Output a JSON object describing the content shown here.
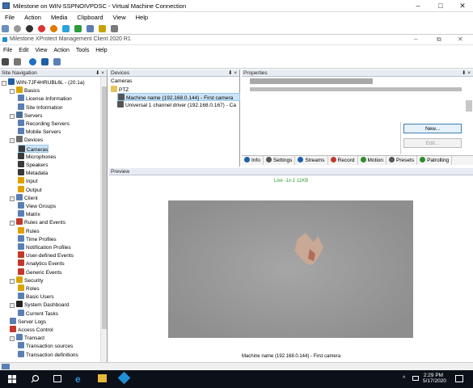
{
  "vm": {
    "title": "Milestone on WIN-SSPNOIVPDSC - Virtual Machine Connection",
    "menu": [
      "File",
      "Action",
      "Media",
      "Clipboard",
      "View",
      "Help"
    ]
  },
  "app": {
    "title": "Milestone XProtect Management Client 2020 R1",
    "menu": [
      "File",
      "Edit",
      "View",
      "Action",
      "Tools",
      "Help"
    ]
  },
  "nav": {
    "header": "Site Navigation",
    "pin": "⬇ ×",
    "items": [
      {
        "label": "WIN-7JF4HRUBL6L - (20.1a)",
        "level": 0,
        "icon": "server-icon",
        "color": "#1f5fa8",
        "exp": "-"
      },
      {
        "label": "Basics",
        "level": 1,
        "icon": "basics-icon",
        "color": "#d9a400",
        "exp": "-"
      },
      {
        "label": "License Information",
        "level": 2,
        "icon": "license-icon",
        "color": "#5b7fb5"
      },
      {
        "label": "Site Information",
        "level": 2,
        "icon": "site-info-icon",
        "color": "#5b7fb5"
      },
      {
        "label": "Servers",
        "level": 1,
        "icon": "servers-icon",
        "color": "#4b6d9a",
        "exp": "-"
      },
      {
        "label": "Recording Servers",
        "level": 2,
        "icon": "recording-server-icon",
        "color": "#5b7fb5"
      },
      {
        "label": "Mobile Servers",
        "level": 2,
        "icon": "mobile-server-icon",
        "color": "#5b7fb5"
      },
      {
        "label": "Devices",
        "level": 1,
        "icon": "devices-icon",
        "color": "#6b6b6b",
        "exp": "-"
      },
      {
        "label": "Cameras",
        "level": 2,
        "icon": "camera-icon",
        "color": "#3a3a3a",
        "selected": true
      },
      {
        "label": "Microphones",
        "level": 2,
        "icon": "microphone-icon",
        "color": "#3a3a3a"
      },
      {
        "label": "Speakers",
        "level": 2,
        "icon": "speaker-icon",
        "color": "#3a3a3a"
      },
      {
        "label": "Metadata",
        "level": 2,
        "icon": "metadata-icon",
        "color": "#3a3a3a"
      },
      {
        "label": "Input",
        "level": 2,
        "icon": "input-icon",
        "color": "#e0a000"
      },
      {
        "label": "Output",
        "level": 2,
        "icon": "output-icon",
        "color": "#e0a000"
      },
      {
        "label": "Client",
        "level": 1,
        "icon": "client-icon",
        "color": "#5b7fb5",
        "exp": "-"
      },
      {
        "label": "View Groups",
        "level": 2,
        "icon": "view-groups-icon",
        "color": "#5b7fb5"
      },
      {
        "label": "Matrix",
        "level": 2,
        "icon": "matrix-icon",
        "color": "#5b7fb5"
      },
      {
        "label": "Rules and Events",
        "level": 1,
        "icon": "rules-events-icon",
        "color": "#c0392b",
        "exp": "-"
      },
      {
        "label": "Rules",
        "level": 2,
        "icon": "rules-icon",
        "color": "#e0a000"
      },
      {
        "label": "Time Profiles",
        "level": 2,
        "icon": "time-profile-icon",
        "color": "#5b7fb5"
      },
      {
        "label": "Notification Profiles",
        "level": 2,
        "icon": "notification-icon",
        "color": "#5b7fb5"
      },
      {
        "label": "User-defined Events",
        "level": 2,
        "icon": "user-event-icon",
        "color": "#c0392b"
      },
      {
        "label": "Analytics Events",
        "level": 2,
        "icon": "analytics-icon",
        "color": "#c0392b"
      },
      {
        "label": "Generic Events",
        "level": 2,
        "icon": "generic-event-icon",
        "color": "#c0392b"
      },
      {
        "label": "Security",
        "level": 1,
        "icon": "security-icon",
        "color": "#d9a400",
        "exp": "-"
      },
      {
        "label": "Roles",
        "level": 2,
        "icon": "roles-icon",
        "color": "#d9a400"
      },
      {
        "label": "Basic Users",
        "level": 2,
        "icon": "basic-users-icon",
        "color": "#5b7fb5"
      },
      {
        "label": "System Dashboard",
        "level": 1,
        "icon": "dashboard-icon",
        "color": "#222",
        "exp": "-"
      },
      {
        "label": "Current Tasks",
        "level": 2,
        "icon": "tasks-icon",
        "color": "#5b7fb5"
      },
      {
        "label": "Server Logs",
        "level": 1,
        "icon": "logs-icon",
        "color": "#5b7fb5"
      },
      {
        "label": "Access Control",
        "level": 1,
        "icon": "access-control-icon",
        "color": "#c0392b"
      },
      {
        "label": "Transact",
        "level": 1,
        "icon": "transact-icon",
        "color": "#5b7fb5",
        "exp": "-"
      },
      {
        "label": "Transaction sources",
        "level": 2,
        "icon": "transaction-source-icon",
        "color": "#5b7fb5"
      },
      {
        "label": "Transaction definitions",
        "level": 2,
        "icon": "transaction-def-icon",
        "color": "#5b7fb5"
      }
    ]
  },
  "devices": {
    "header": "Devices",
    "pin": "⬇ ×",
    "root": "Cameras",
    "group": "PTZ",
    "items": [
      {
        "label": "Machine name (192.168.0.144) - First camera",
        "selected": true
      },
      {
        "label": "Universal 1 channel driver (192.168.0.167) - Ca",
        "selected": false
      }
    ]
  },
  "props": {
    "header": "Properties",
    "pin": "⬇ ×",
    "new_button": "New...",
    "edit_button": "Edit...",
    "tabs": [
      {
        "label": "Info",
        "icon": "info-icon",
        "color": "#1f5fa8"
      },
      {
        "label": "Settings",
        "icon": "settings-icon",
        "color": "#555"
      },
      {
        "label": "Streams",
        "icon": "streams-icon",
        "color": "#1f5fa8"
      },
      {
        "label": "Record",
        "icon": "record-icon",
        "color": "#c0392b"
      },
      {
        "label": "Motion",
        "icon": "motion-icon",
        "color": "#2e8b2e"
      },
      {
        "label": "Presets",
        "icon": "presets-icon",
        "color": "#555"
      },
      {
        "label": "Patrolling",
        "icon": "patrolling-icon",
        "color": "#2e8b2e"
      }
    ]
  },
  "preview": {
    "header": "Preview",
    "status": "Live  -1x-1  11KB",
    "caption": "Machine name (192.168.0.144) - First camera"
  },
  "taskbar": {
    "time": "2:29 PM",
    "date": "5/17/2020"
  }
}
